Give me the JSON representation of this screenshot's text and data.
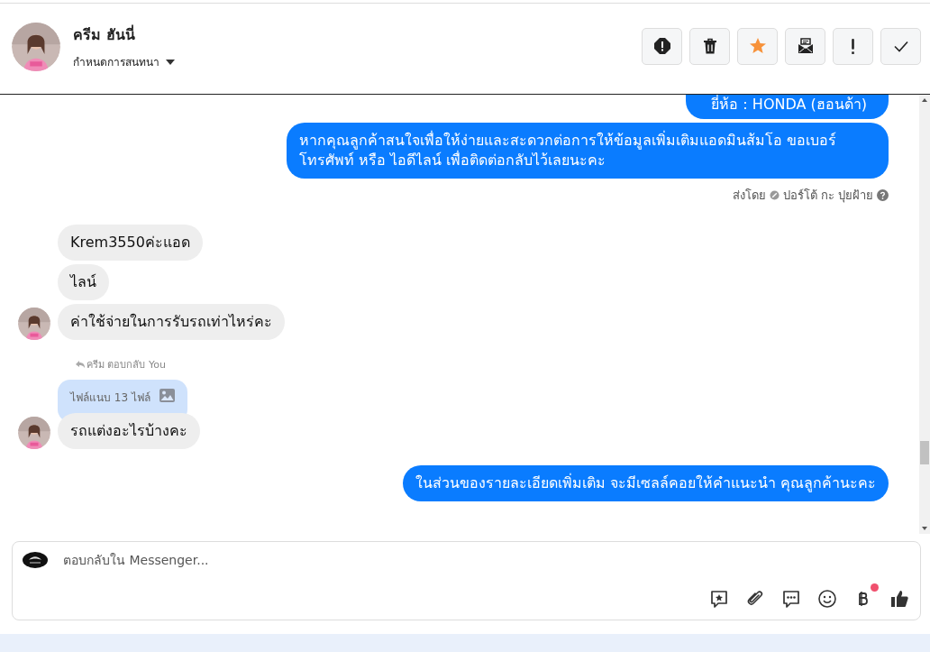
{
  "header": {
    "name": "ครีม ฮันนี่",
    "subtitle": "กำหนดการสนทนา"
  },
  "toolbar": [
    {
      "kind": "alert"
    },
    {
      "kind": "trash"
    },
    {
      "kind": "star",
      "on": true
    },
    {
      "kind": "envelope"
    },
    {
      "kind": "exclaim"
    },
    {
      "kind": "check"
    }
  ],
  "messages": [
    {
      "kind": "sent",
      "text": "ยี่ห้อ : HONDA (ฮอนด้า)"
    },
    {
      "kind": "sent",
      "text": "หากคุณลูกค้าสนใจเพื่อให้ง่ายและสะดวกต่อการให้ข้อมูลเพิ่มเติมแอดมินส้มโอ ขอเบอร์โทรศัพท์ หรือ ไอดีไลน์ เพื่อติดต่อกลับไว้เลยนะคะ"
    },
    {
      "kind": "sent_by",
      "label": "ส่งโดย",
      "name": "ปอร์โต้ กะ ปุยฝ้าย"
    },
    {
      "kind": "received",
      "text": "Krem3550ค่ะแอด",
      "avatar": false
    },
    {
      "kind": "received",
      "text": "ไลน์",
      "avatar": false
    },
    {
      "kind": "received",
      "text": "ค่าใช้จ่ายในการรับรถเท่าไหร่คะ",
      "avatar": true
    },
    {
      "kind": "reply_note",
      "text": "ครีม ตอบกลับ You"
    },
    {
      "kind": "attachment",
      "text": "ไฟล์แนบ 13 ไฟล์"
    },
    {
      "kind": "received",
      "text": "รถแต่งอะไรบ้างคะ",
      "avatar": true
    },
    {
      "kind": "sent",
      "text": "ในส่วนของรายละเอียดเพิ่มเติม จะมีเซลล์คอยให้คำแนะนำ คุณลูกค้านะคะ"
    }
  ],
  "composer": {
    "placeholder": "ตอบกลับใน Messenger...",
    "tools": [
      {
        "kind": "saved-reply"
      },
      {
        "kind": "attach"
      },
      {
        "kind": "chat"
      },
      {
        "kind": "emoji"
      },
      {
        "kind": "baht",
        "badge": true
      },
      {
        "kind": "like"
      }
    ]
  }
}
